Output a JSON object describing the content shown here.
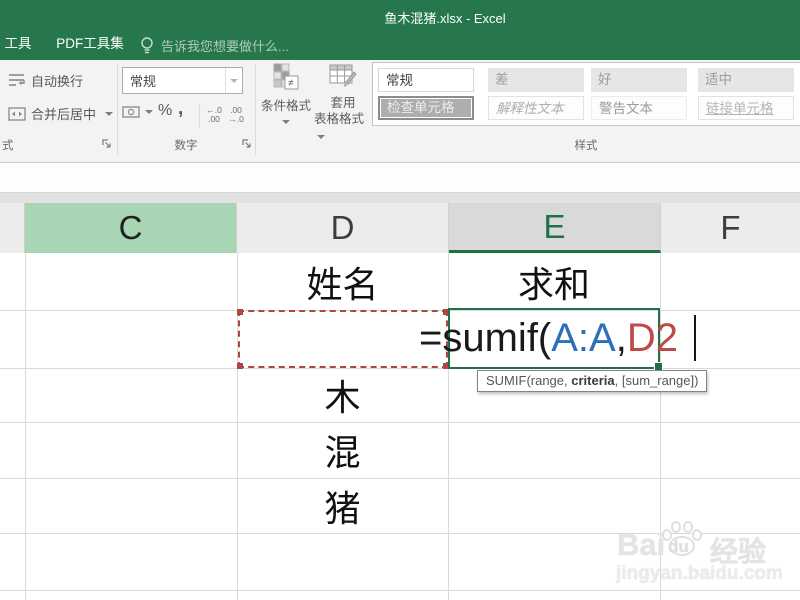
{
  "window": {
    "title": "鱼木混猪.xlsx - Excel"
  },
  "tabs": {
    "partial_tab": "工具",
    "pdf_tab": "PDF工具集",
    "tellme": "告诉我您想要做什么..."
  },
  "ribbon": {
    "wrap_text_label": "自动换行",
    "merge_center_label": "合并后居中",
    "alignment_group_label": "式",
    "number_format_value": "常规",
    "percent_label": "%",
    "comma_label": ",",
    "inc_decimal": {
      "top": "←.0",
      "bottom": ".00"
    },
    "dec_decimal": {
      "top": ".00",
      "bottom": "→.0"
    },
    "number_group_label": "数字",
    "conditional_formatting_label": "条件格式",
    "format_as_table_line1": "套用",
    "format_as_table_line2": "表格格式",
    "style_group_label": "样式",
    "style_gallery": {
      "chips": [
        {
          "label": "常规"
        },
        {
          "label": "差"
        },
        {
          "label": "好"
        },
        {
          "label": "适中"
        },
        {
          "label": "检查单元格"
        },
        {
          "label": "解释性文本"
        },
        {
          "label": "警告文本"
        },
        {
          "label": "链接单元格"
        }
      ]
    }
  },
  "grid": {
    "columns": [
      {
        "letter": "C",
        "state": "highlighted-green"
      },
      {
        "letter": "D",
        "state": "normal"
      },
      {
        "letter": "E",
        "state": "active-column"
      },
      {
        "letter": "F",
        "state": "normal"
      }
    ],
    "cells": {
      "d1": "姓名",
      "e1": "求和",
      "d3": "木",
      "d4": "混",
      "d5": "猪"
    }
  },
  "formula": {
    "parts": [
      {
        "text": "=sumif(",
        "color": "#1a1a1a"
      },
      {
        "text": "A:A",
        "color": "#2E6FBA"
      },
      {
        "text": ",",
        "color": "#1a1a1a"
      },
      {
        "text": "D2",
        "color": "#BE4B48"
      }
    ]
  },
  "tooltip": {
    "pre": "SUMIF(range, ",
    "bold": "criteria",
    "post": ", [sum_range])"
  },
  "watermark": {
    "bai": "Bai",
    "du": "du",
    "jingyan": "经验",
    "url": "jingyan.baidu.com"
  },
  "colors": {
    "excel_green": "#27774C",
    "active_cell_green": "#1F7145",
    "column_highlight_green": "#A8D5B4",
    "marching_ants_red": "#B0473F",
    "reference_blue": "#2E6FBA",
    "reference_red": "#BE4B48"
  }
}
